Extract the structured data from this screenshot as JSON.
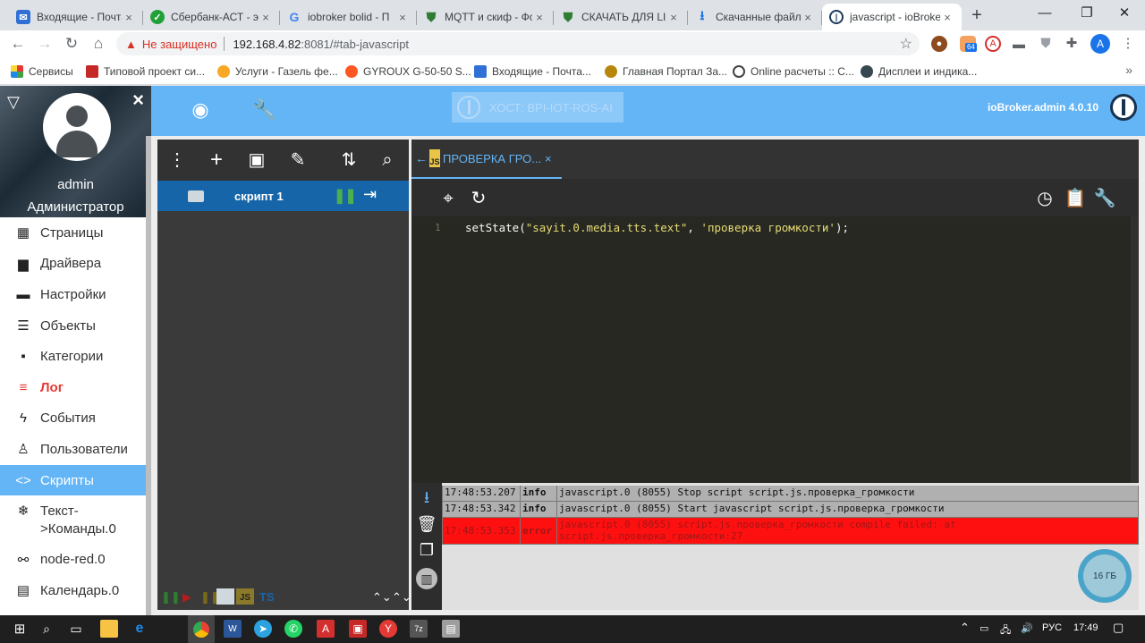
{
  "browser": {
    "tabs": [
      {
        "title": "Входящие - Почта",
        "icon": "mail-icon",
        "color": "#2f6fd6"
      },
      {
        "title": "Сбербанк-АСТ - э",
        "icon": "sberbank-icon",
        "color": "#21a038"
      },
      {
        "title": "iobroker bolid - П",
        "icon": "google-icon",
        "color": "#4285f4"
      },
      {
        "title": "MQTT и скиф - Фо",
        "icon": "shield-icon",
        "color": "#2e7d32"
      },
      {
        "title": "СКАЧАТЬ ДЛЯ LIN",
        "icon": "shield-icon",
        "color": "#2e7d32"
      },
      {
        "title": "Скачанные файлы",
        "icon": "download-icon",
        "color": "#1a73e8"
      },
      {
        "title": "javascript - ioBroke",
        "icon": "iobroker-icon",
        "color": "#1c3a5e"
      }
    ],
    "security_label": "Не защищено",
    "url_host": "192.168.4.82",
    "url_path": ":8081/#tab-javascript",
    "profile_initial": "A",
    "extension_badge": "64",
    "bookmarks": [
      {
        "label": "Сервисы",
        "color": "#e53935"
      },
      {
        "label": "Типовой проект си...",
        "color": "#c62828"
      },
      {
        "label": "Услуги - Газель фе...",
        "color": "#f9a825"
      },
      {
        "label": "GYROUX G-50-50 S...",
        "color": "#ff5722"
      },
      {
        "label": "Входящие - Почта...",
        "color": "#2f6fd6"
      },
      {
        "label": "Главная Портал За...",
        "color": "#b8860b"
      },
      {
        "label": "Online расчеты :: С...",
        "color": "#424242"
      },
      {
        "label": "Дисплеи и индика...",
        "color": "#37474f"
      }
    ]
  },
  "header": {
    "host_label": "ХОСТ: BPI-IOT-ROS-AI",
    "version": "ioBroker.admin 4.0.10"
  },
  "user": {
    "name": "admin",
    "role": "Администратор"
  },
  "menu": [
    {
      "label": "Страницы",
      "icon": "grid-icon",
      "glyph": "▦"
    },
    {
      "label": "Драйвера",
      "icon": "store-icon",
      "glyph": "▆"
    },
    {
      "label": "Настройки",
      "icon": "keyboard-icon",
      "glyph": "▬"
    },
    {
      "label": "Объекты",
      "icon": "list-icon",
      "glyph": "☰"
    },
    {
      "label": "Категории",
      "icon": "category-icon",
      "glyph": "▪"
    },
    {
      "label": "Лог",
      "icon": "log-icon",
      "glyph": "≡"
    },
    {
      "label": "События",
      "icon": "flash-icon",
      "glyph": "ϟ"
    },
    {
      "label": "Пользователи",
      "icon": "person-icon",
      "glyph": "♙"
    },
    {
      "label": "Скрипты",
      "icon": "code-icon",
      "glyph": "<>"
    },
    {
      "label": "Текст-\n>Команды.0",
      "icon": "snowflake-icon",
      "glyph": "❄"
    },
    {
      "label": "node-red.0",
      "icon": "node-red-icon",
      "glyph": "⚯"
    },
    {
      "label": "Календарь.0",
      "icon": "calendar-icon",
      "glyph": "▤"
    }
  ],
  "scripts": {
    "tree_item": "скрипт 1",
    "open_tab": "ПРОВЕРКА ГРО...",
    "line_number": "1",
    "code_fn": "setState(",
    "code_arg1": "\"sayit.0.media.tts.text\"",
    "code_sep": ", ",
    "code_arg2": "'проверка громкости'",
    "code_end": ");"
  },
  "logs": [
    {
      "time": "17:48:53.207",
      "level": "info",
      "msg": "javascript.0 (8055) Stop script script.js.проверка_громкости"
    },
    {
      "time": "17:48:53.342",
      "level": "info",
      "msg": "javascript.0 (8055) Start javascript script.js.проверка_громкости"
    },
    {
      "time": "17:48:53.353",
      "level": "error",
      "msg": "javascript.0 (8055) script.js.проверка_громкости compile failed: at script.js.проверка_громкости:27"
    }
  ],
  "memory": "16 ГБ",
  "taskbar": {
    "lang": "РУС",
    "time": "17:49"
  }
}
